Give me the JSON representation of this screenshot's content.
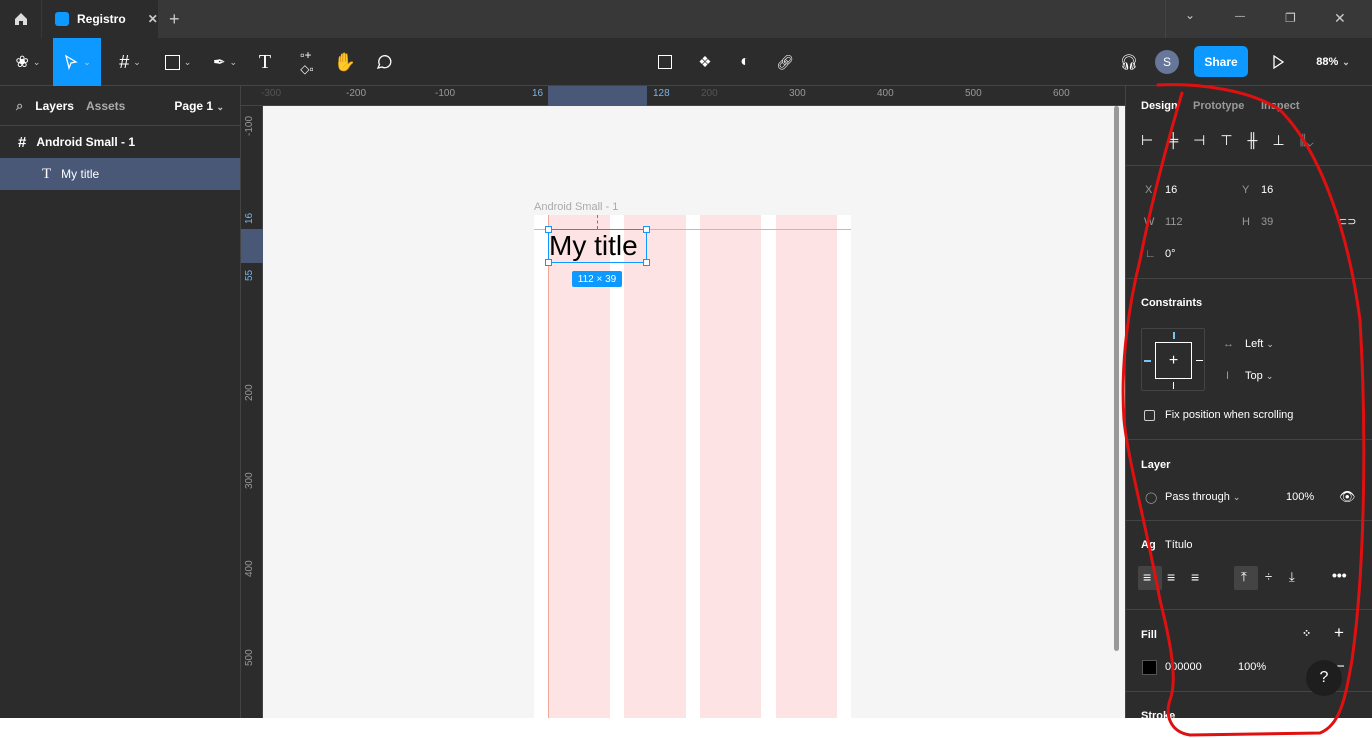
{
  "tabs": {
    "home_icon": "home-icon",
    "file_tab": "Registro",
    "close": "✕",
    "new_tab": "+"
  },
  "window": {
    "minimize": "—",
    "restore": "❐",
    "close": "✕",
    "menu": "⌄"
  },
  "toolbar": {
    "share": "Share",
    "avatar": "S",
    "zoom": "88%"
  },
  "left": {
    "layers": "Layers",
    "assets": "Assets",
    "page": "Page 1",
    "layers_list": [
      {
        "name": "Android Small - 1",
        "type": "frame"
      },
      {
        "name": "My title",
        "type": "text",
        "selected": true
      }
    ]
  },
  "rulers": {
    "top": [
      "-300",
      "-200",
      "-100",
      "16",
      "128",
      "200",
      "300",
      "400",
      "500",
      "600"
    ],
    "left": [
      "-100",
      "16",
      "55",
      "200",
      "300",
      "400",
      "500"
    ]
  },
  "canvas": {
    "frame_label": "Android Small - 1",
    "text": "My title",
    "size_badge": "112 × 39",
    "accent": "#0d99ff",
    "grid_color": "#fde3e3"
  },
  "design": {
    "tabs": [
      "Design",
      "Prototype",
      "Inspect"
    ],
    "x_label": "X",
    "x": "16",
    "y_label": "Y",
    "y": "16",
    "w_label": "W",
    "w": "112",
    "h_label": "H",
    "h": "39",
    "rotation": "0°",
    "constraints_title": "Constraints",
    "h_constraint": "Left",
    "v_constraint": "Top",
    "fix_position": "Fix position when scrolling",
    "layer_title": "Layer",
    "blend": "Pass through",
    "opacity": "100%",
    "text_style_icon": "Ag",
    "text_style": "Título",
    "fill_title": "Fill",
    "fill_hex": "000000",
    "fill_opacity": "100%",
    "fill_color": "#000000",
    "stroke_title": "Stroke",
    "help": "?"
  },
  "annotation": {
    "color": "#e01010"
  }
}
